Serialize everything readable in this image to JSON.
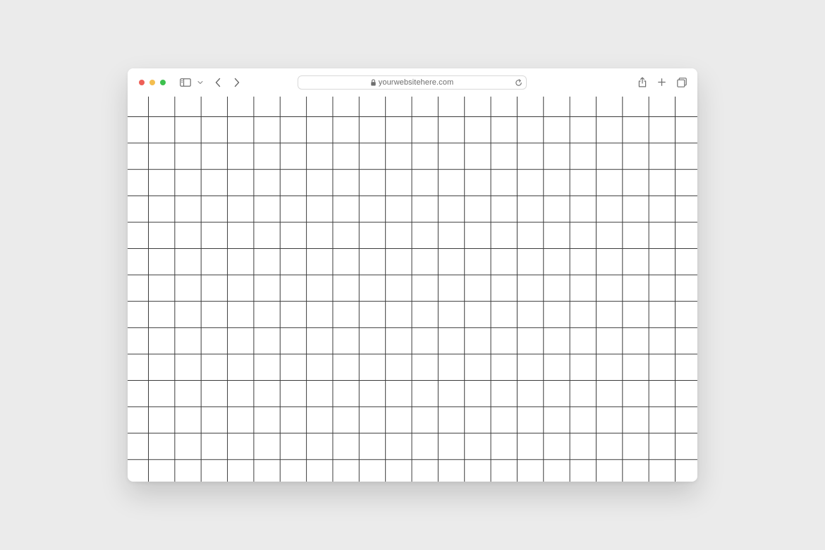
{
  "window": {
    "traffic_lights": {
      "close": "#ee5f57",
      "minimize": "#f4be4f",
      "maximize": "#3dc14e"
    }
  },
  "toolbar": {
    "icons": {
      "sidebar": "sidebar-toggle-icon",
      "sidebar_menu": "chevron-down-icon",
      "back": "chevron-left-icon",
      "forward": "chevron-right-icon",
      "share": "share-icon",
      "new_tab": "plus-icon",
      "tabs_overview": "tabs-overview-icon"
    }
  },
  "address_bar": {
    "url": "yourwebsitehere.com",
    "lock_icon": "lock-icon",
    "reload_icon": "reload-icon"
  },
  "content": {
    "grid_line_color": "#3c3c3c",
    "background": "#ffffff"
  }
}
